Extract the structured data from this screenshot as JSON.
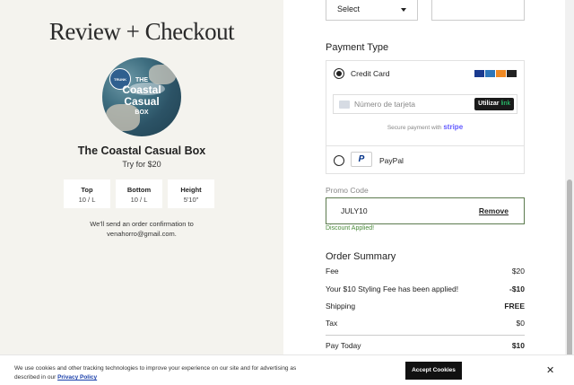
{
  "left": {
    "title": "Review + Checkout",
    "box_image": {
      "the": "THE",
      "main1": "Coastal",
      "main2": "Casual",
      "sub": "BOX",
      "badge": "TRUNK"
    },
    "box_name": "The Coastal Casual Box",
    "box_price": "Try for $20",
    "sizes": [
      {
        "label": "Top",
        "value": "10 / L"
      },
      {
        "label": "Bottom",
        "value": "10 / L"
      },
      {
        "label": "Height",
        "value": "5'10\""
      }
    ],
    "confirmation_line1": "We'll send an order confirmation to",
    "confirmation_email": "venahorro@gmail.com."
  },
  "right": {
    "select_value": "Select",
    "payment_type_title": "Payment Type",
    "credit_card_label": "Credit Card",
    "card_number_placeholder": "Número de tarjeta",
    "link_button": {
      "prefix": "Utilizar",
      "link": "link"
    },
    "secure_text": "Secure payment with",
    "stripe": "stripe",
    "paypal_label": "PayPal",
    "paypal_logo": "P",
    "promo_label": "Promo Code",
    "promo_value": "JULY10",
    "promo_remove": "Remove",
    "discount_status": "Discount Applied!",
    "order_summary_title": "Order Summary",
    "summary": [
      {
        "label": "Fee",
        "value": "$20",
        "bold": false
      },
      {
        "label": "Your $10 Styling Fee has been applied!",
        "value": "-$10",
        "bold": true
      },
      {
        "label": "Shipping",
        "value": "FREE",
        "bold": true
      },
      {
        "label": "Tax",
        "value": "$0",
        "bold": false
      },
      {
        "label": "Pay Today",
        "value": "$10",
        "bold": true
      }
    ]
  },
  "cookie": {
    "text": "We use cookies and other tracking technologies to improve your experience on our site and for advertising as described in our",
    "policy_link": "Privacy Policy",
    "accept_label": "Accept Cookies",
    "close": "✕"
  },
  "colors": {
    "left_bg": "#f4f3ee",
    "promo_border": "#5c7a4e",
    "discount": "#4a8a3a",
    "stripe": "#635bff"
  }
}
